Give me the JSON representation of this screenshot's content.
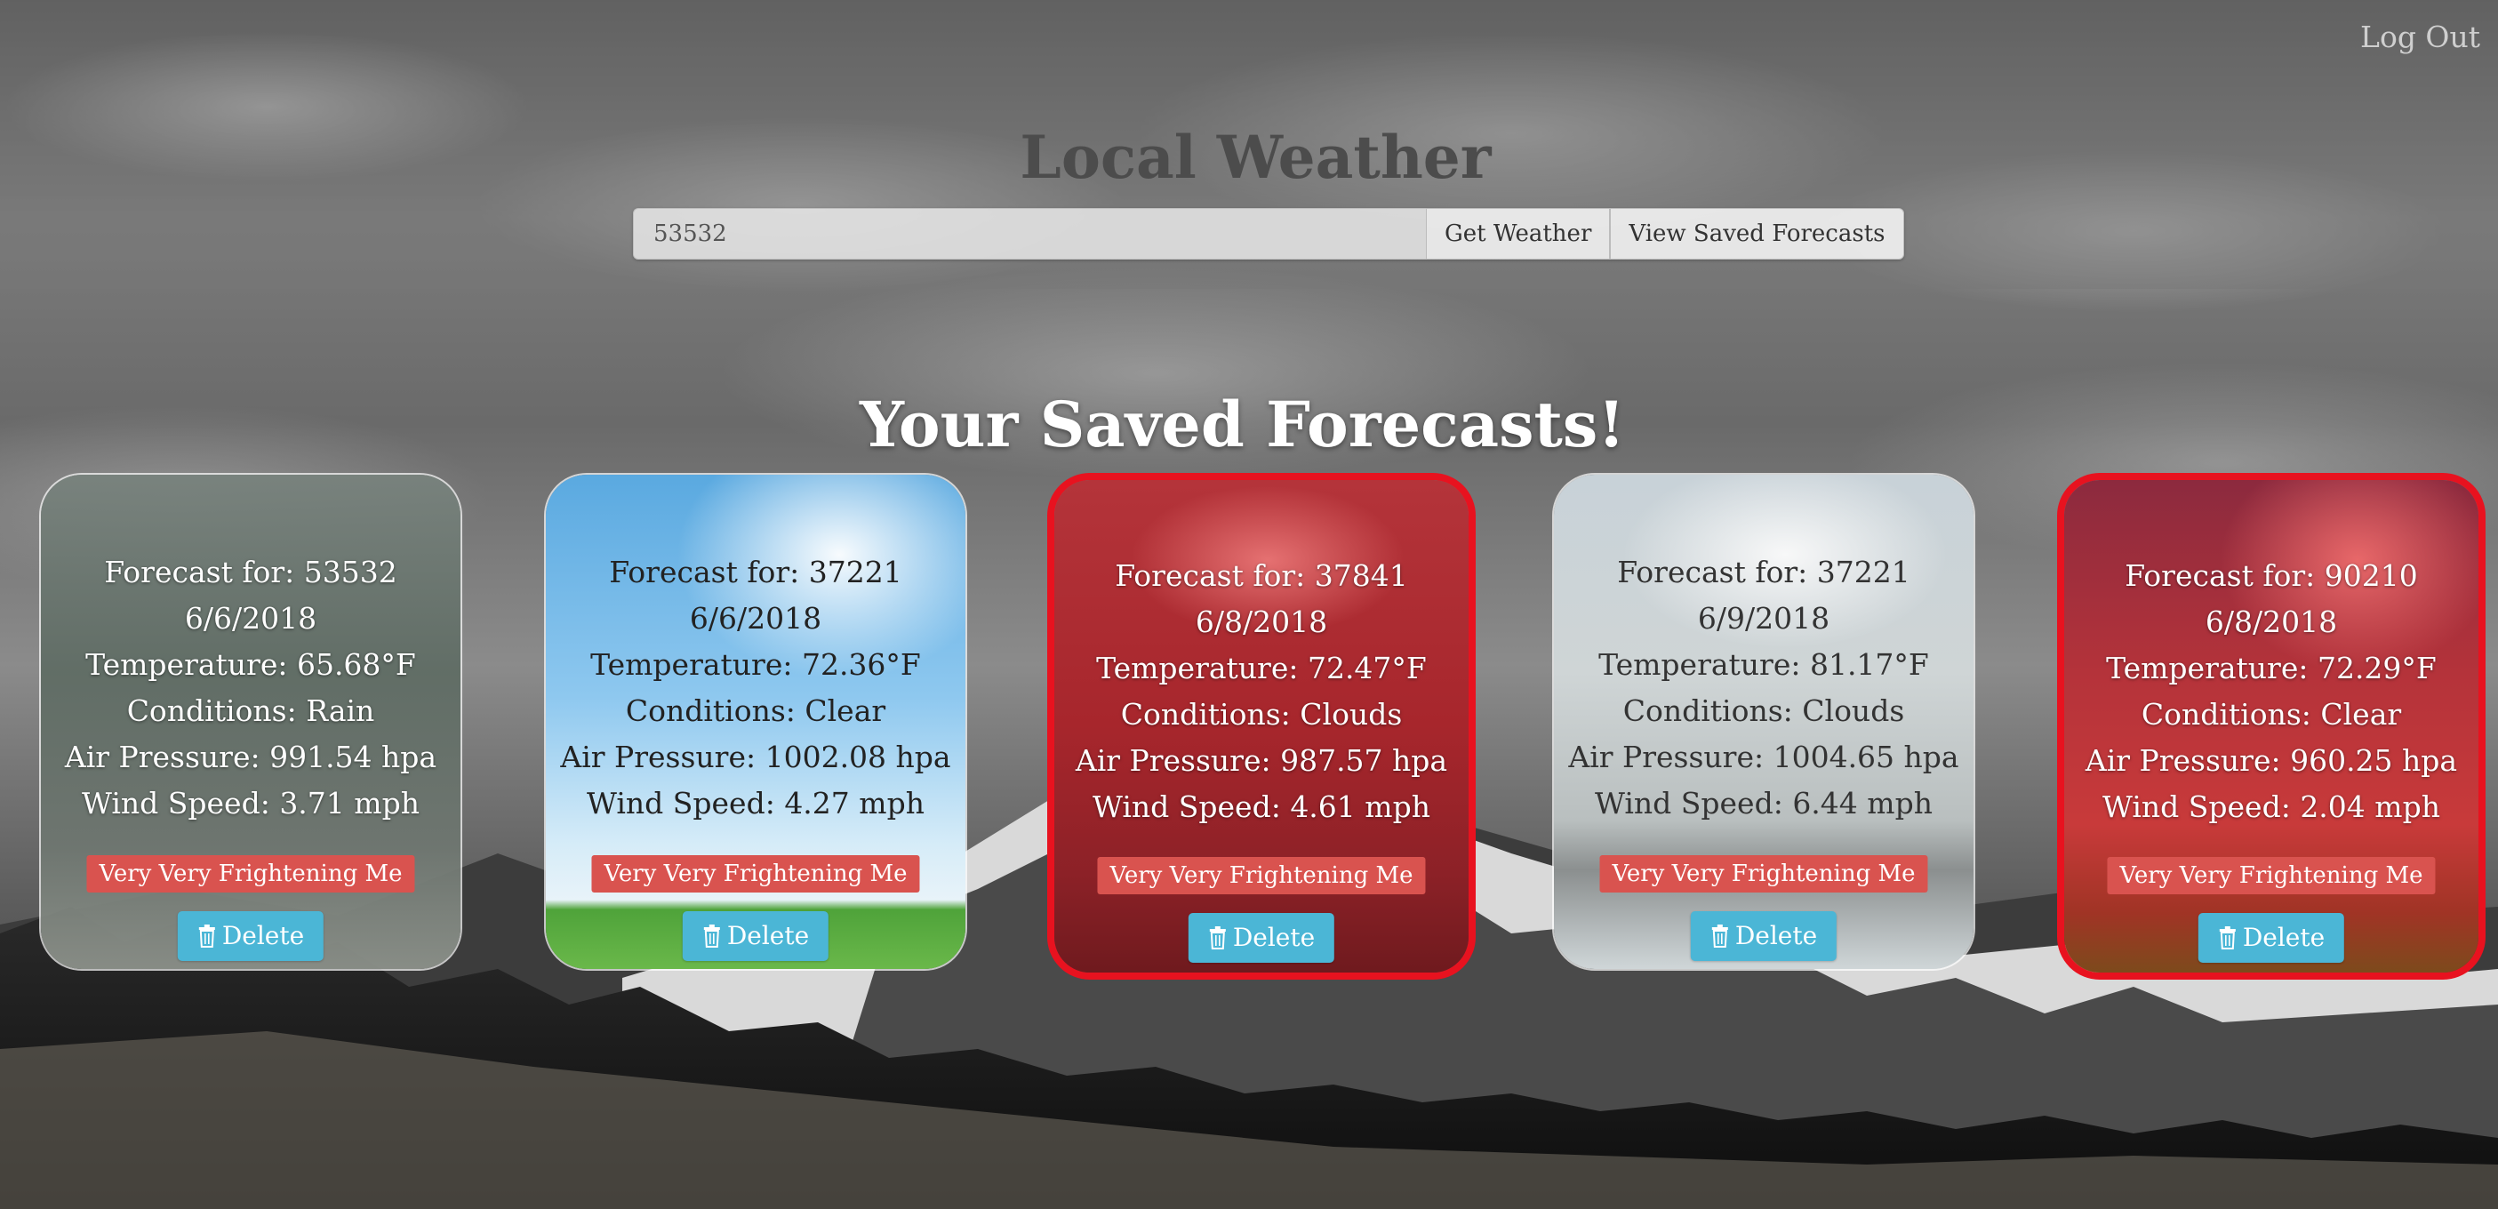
{
  "header": {
    "logout_label": "Log Out",
    "title": "Local Weather",
    "search": {
      "value": "53532",
      "placeholder": ""
    },
    "get_weather_label": "Get Weather",
    "view_saved_label": "View Saved Forecasts"
  },
  "main": {
    "heading": "Your Saved Forecasts!",
    "tag_label": "Very Very Frightening Me",
    "delete_label": "Delete",
    "cards": [
      {
        "zip_line": "Forecast for: 53532",
        "date": "6/6/2018",
        "temperature": "Temperature: 65.68°F",
        "conditions": "Conditions: Rain",
        "pressure": "Air Pressure: 991.54 hpa",
        "wind": "Wind Speed: 3.71 mph",
        "theme": "rain",
        "alert": false
      },
      {
        "zip_line": "Forecast for: 37221",
        "date": "6/6/2018",
        "temperature": "Temperature: 72.36°F",
        "conditions": "Conditions: Clear",
        "pressure": "Air Pressure: 1002.08 hpa",
        "wind": "Wind Speed: 4.27 mph",
        "theme": "clear",
        "alert": false
      },
      {
        "zip_line": "Forecast for: 37841",
        "date": "6/8/2018",
        "temperature": "Temperature: 72.47°F",
        "conditions": "Conditions: Clouds",
        "pressure": "Air Pressure: 987.57 hpa",
        "wind": "Wind Speed: 4.61 mph",
        "theme": "clouds-red",
        "alert": true
      },
      {
        "zip_line": "Forecast for: 37221",
        "date": "6/9/2018",
        "temperature": "Temperature: 81.17°F",
        "conditions": "Conditions: Clouds",
        "pressure": "Air Pressure: 1004.65 hpa",
        "wind": "Wind Speed: 6.44 mph",
        "theme": "clouds",
        "alert": false
      },
      {
        "zip_line": "Forecast for: 90210",
        "date": "6/8/2018",
        "temperature": "Temperature: 72.29°F",
        "conditions": "Conditions: Clear",
        "pressure": "Air Pressure: 960.25 hpa",
        "wind": "Wind Speed: 2.04 mph",
        "theme": "clear-red",
        "alert": true
      }
    ]
  },
  "colors": {
    "alert_border": "#e8121f",
    "tag_bg": "#d9534f",
    "delete_bg": "#4bb6d6"
  }
}
